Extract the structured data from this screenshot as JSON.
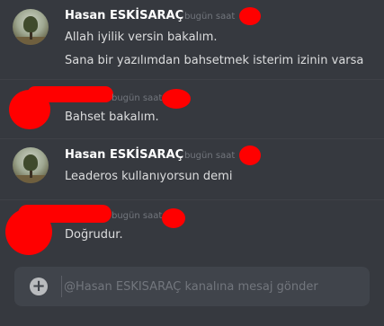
{
  "messages": [
    {
      "author": "Hasan ESKİSARAÇ",
      "timestamp": "bugün saat",
      "lines": [
        "Allah iyilik versin bakalım.",
        "Sana bir yazılımdan bahsetmek isterim izinin varsa"
      ]
    },
    {
      "author": "",
      "timestamp": "bugün saat",
      "lines": [
        "Bahset bakalım."
      ]
    },
    {
      "author": "Hasan ESKİSARAÇ",
      "timestamp": "bugün saat",
      "lines": [
        "Leaderos kullanıyorsun demi"
      ]
    },
    {
      "author": "",
      "timestamp": "bugün saat",
      "lines": [
        "Doğrudur."
      ]
    }
  ],
  "composer": {
    "placeholder": "@Hasan ESKİSARAÇ kanalına mesaj gönder",
    "value": ""
  },
  "colors": {
    "background": "#36393f",
    "input_background": "#40444b",
    "redaction": "#ff0000",
    "username": "#ffffff",
    "message_text": "#dcddde",
    "timestamp": "#72767d"
  }
}
